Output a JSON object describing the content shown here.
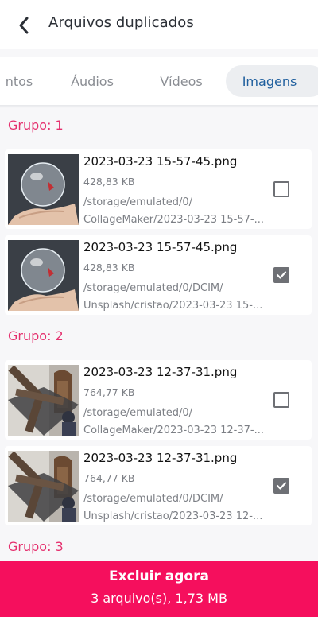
{
  "header": {
    "title": "Arquivos duplicados",
    "back_icon": "chevron-left-icon"
  },
  "tabs": [
    {
      "label": "ntos",
      "active": false
    },
    {
      "label": "Áudios",
      "active": false
    },
    {
      "label": "Vídeos",
      "active": false
    },
    {
      "label": "Imagens",
      "active": true
    }
  ],
  "colors": {
    "accent": "#e5306e",
    "footer": "#f50f5d",
    "active_tab_text": "#1f5f9e",
    "checkbox": "#6e7075"
  },
  "groups": [
    {
      "title": "Grupo: 1",
      "items": [
        {
          "name": "2023-03-23 15-57-45.png",
          "size": "428,83 KB",
          "path_line1": "/storage/emulated/0/",
          "path_line2": "CollageMaker/2023-03-23 15-57-...",
          "checked": false,
          "thumb": "crystal-ball-hand-image"
        },
        {
          "name": "2023-03-23 15-57-45.png",
          "size": "428,83 KB",
          "path_line1": "/storage/emulated/0/DCIM/",
          "path_line2": "Unsplash/cristao/2023-03-23 15-...",
          "checked": true,
          "thumb": "crystal-ball-hand-image"
        }
      ]
    },
    {
      "title": "Grupo: 2",
      "items": [
        {
          "name": "2023-03-23 12-37-31.png",
          "size": "764,77 KB",
          "path_line1": "/storage/emulated/0/",
          "path_line2": "CollageMaker/2023-03-23 12-37-...",
          "checked": false,
          "thumb": "wooden-cross-image"
        },
        {
          "name": "2023-03-23 12-37-31.png",
          "size": "764,77 KB",
          "path_line1": "/storage/emulated/0/DCIM/",
          "path_line2": "Unsplash/cristao/2023-03-23 12-...",
          "checked": true,
          "thumb": "wooden-cross-image"
        }
      ]
    },
    {
      "title": "Grupo: 3",
      "items": []
    }
  ],
  "footer": {
    "action_label": "Excluir agora",
    "summary": "3 arquivo(s), 1,73 MB"
  }
}
